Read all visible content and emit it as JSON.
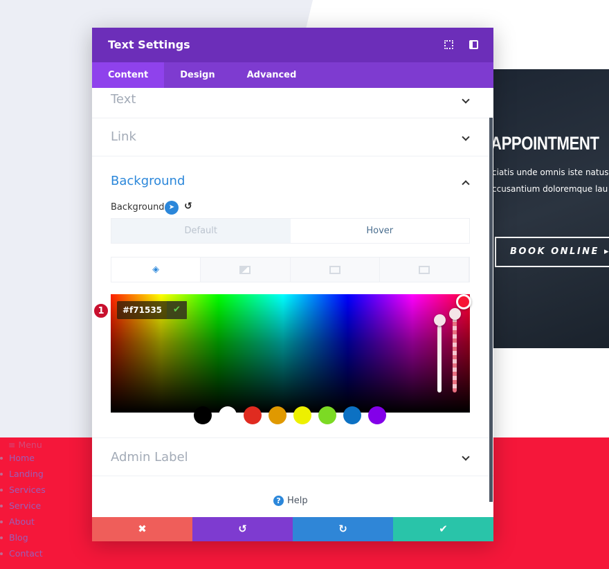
{
  "menu": {
    "title": "≡ Menu",
    "items": [
      "Home",
      "Landing",
      "Services",
      "Service",
      "About",
      "Blog",
      "Contact"
    ]
  },
  "hero": {
    "title": "APPOINTMENT",
    "line1": "ciatis unde omnis iste natus",
    "line2": "ccusantium doloremque lau",
    "button": "BOOK ONLINE ▸"
  },
  "modal": {
    "title": "Text Settings",
    "tabs": [
      "Content",
      "Design",
      "Advanced"
    ],
    "sections": {
      "text": "Text",
      "link": "Link",
      "background": "Background",
      "admin": "Admin Label"
    },
    "bg_label": "Background",
    "toggle": {
      "default": "Default",
      "hover": "Hover"
    },
    "hex_value": "#f71535",
    "swatches": [
      "#000000",
      "#ffffff",
      "#e02b20",
      "#e09900",
      "#edf000",
      "#7cda24",
      "#0c71c3",
      "#8300e9"
    ],
    "help": "Help",
    "badge": "1"
  },
  "colors": {
    "header": "#6c2eb9",
    "tabs": "#7e3bd0",
    "accent": "#2b87da",
    "cancel": "#ef5e5a",
    "undo": "#7e3bd0",
    "redo": "#2f86d7",
    "save": "#29c4a9",
    "footer_band": "#f5173a"
  }
}
